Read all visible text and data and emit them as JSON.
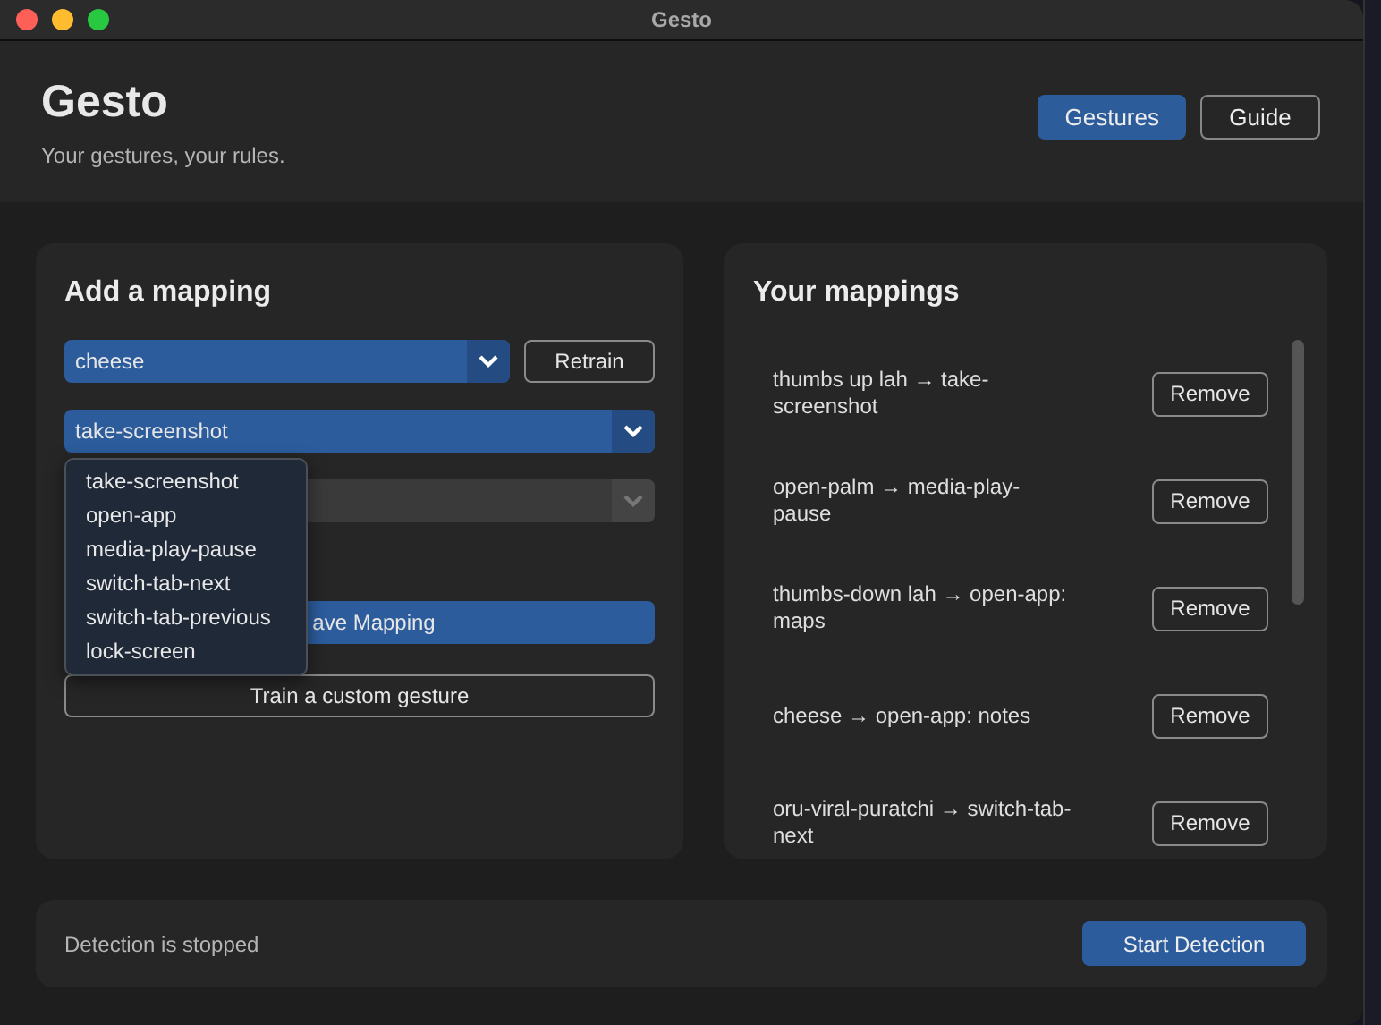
{
  "window": {
    "title": "Gesto"
  },
  "header": {
    "title": "Gesto",
    "subtitle": "Your gestures, your rules.",
    "nav": [
      {
        "label": "Gestures",
        "selected": true
      },
      {
        "label": "Guide",
        "selected": false
      }
    ]
  },
  "add_mapping": {
    "title": "Add a mapping",
    "gesture_select": {
      "value": "cheese"
    },
    "retrain_button": "Retrain",
    "action_select": {
      "value": "take-screenshot",
      "expanded": true,
      "options": [
        "take-screenshot",
        "open-app",
        "media-play-pause",
        "switch-tab-next",
        "switch-tab-previous",
        "lock-screen"
      ]
    },
    "app_select": {
      "disabled": true
    },
    "save_button": "ave Mapping",
    "train_button": "Train a custom gesture"
  },
  "mappings": {
    "title": "Your mappings",
    "items": [
      {
        "text": "thumbs up lah → take-screenshot",
        "button": "Remove"
      },
      {
        "text": "open-palm → media-play-pause",
        "button": "Remove"
      },
      {
        "text": "thumbs-down lah → open-app: maps",
        "button": "Remove"
      },
      {
        "text": "cheese → open-app: notes",
        "button": "Remove"
      },
      {
        "text": "oru-viral-puratchi → switch-tab-next",
        "button": "Remove"
      }
    ]
  },
  "status": {
    "text": "Detection is stopped",
    "button": "Start Detection"
  }
}
